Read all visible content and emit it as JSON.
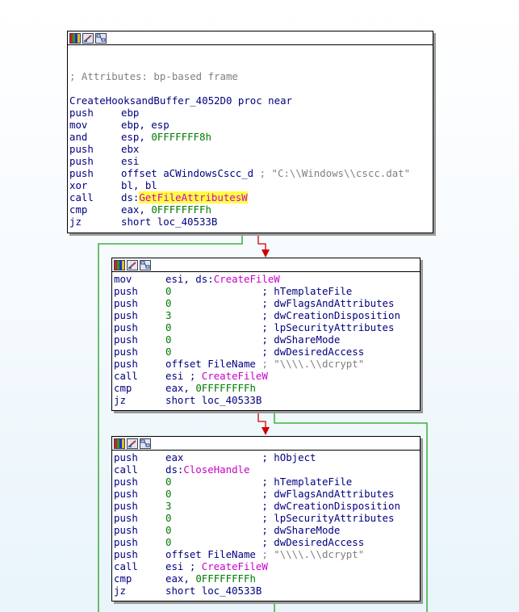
{
  "blocks": [
    {
      "id": "block-1",
      "lines": [
        {
          "kind": "blank"
        },
        {
          "kind": "blank"
        },
        {
          "kind": "comment",
          "text": "; Attributes: bp-based frame"
        },
        {
          "kind": "blank"
        },
        {
          "kind": "proc",
          "text": "CreateHooksandBuffer_4052D0 proc near"
        },
        {
          "kind": "instr",
          "mnem": "push",
          "parts": [
            {
              "t": "op",
              "v": "ebp"
            }
          ]
        },
        {
          "kind": "instr",
          "mnem": "mov",
          "parts": [
            {
              "t": "op",
              "v": "ebp, esp"
            }
          ]
        },
        {
          "kind": "instr",
          "mnem": "and",
          "parts": [
            {
              "t": "op",
              "v": "esp, "
            },
            {
              "t": "num",
              "v": "0FFFFFFF8h"
            }
          ]
        },
        {
          "kind": "instr",
          "mnem": "push",
          "parts": [
            {
              "t": "op",
              "v": "ebx"
            }
          ]
        },
        {
          "kind": "instr",
          "mnem": "push",
          "parts": [
            {
              "t": "op",
              "v": "esi"
            }
          ]
        },
        {
          "kind": "instr",
          "mnem": "push",
          "parts": [
            {
              "t": "op",
              "v": "offset aCWindowsCscc_d "
            },
            {
              "t": "cmt",
              "v": "; \"C:\\\\Windows\\\\cscc.dat\""
            }
          ]
        },
        {
          "kind": "instr",
          "mnem": "xor",
          "parts": [
            {
              "t": "op",
              "v": "bl, bl"
            }
          ]
        },
        {
          "kind": "instr",
          "mnem": "call",
          "parts": [
            {
              "t": "op",
              "v": "ds:"
            },
            {
              "t": "hl",
              "v": "GetFileAttributesW"
            }
          ]
        },
        {
          "kind": "instr",
          "mnem": "cmp",
          "parts": [
            {
              "t": "op",
              "v": "eax, "
            },
            {
              "t": "num",
              "v": "0FFFFFFFFh"
            }
          ]
        },
        {
          "kind": "instr",
          "mnem": "jz",
          "parts": [
            {
              "t": "op",
              "v": "short loc_40533B"
            }
          ]
        }
      ]
    },
    {
      "id": "block-2",
      "lines": [
        {
          "kind": "instr",
          "mnem": "mov",
          "parts": [
            {
              "t": "op",
              "v": "esi, ds:"
            },
            {
              "t": "imp",
              "v": "CreateFileW"
            }
          ]
        },
        {
          "kind": "instr",
          "mnem": "push",
          "parts": [
            {
              "t": "num",
              "v": "0               "
            },
            {
              "t": "op",
              "v": "; "
            },
            {
              "t": "cmtv",
              "v": "hTemplateFile"
            }
          ]
        },
        {
          "kind": "instr",
          "mnem": "push",
          "parts": [
            {
              "t": "num",
              "v": "0               "
            },
            {
              "t": "op",
              "v": "; "
            },
            {
              "t": "cmtv",
              "v": "dwFlagsAndAttributes"
            }
          ]
        },
        {
          "kind": "instr",
          "mnem": "push",
          "parts": [
            {
              "t": "num",
              "v": "3               "
            },
            {
              "t": "op",
              "v": "; "
            },
            {
              "t": "cmtv",
              "v": "dwCreationDisposition"
            }
          ]
        },
        {
          "kind": "instr",
          "mnem": "push",
          "parts": [
            {
              "t": "num",
              "v": "0               "
            },
            {
              "t": "op",
              "v": "; "
            },
            {
              "t": "cmtv",
              "v": "lpSecurityAttributes"
            }
          ]
        },
        {
          "kind": "instr",
          "mnem": "push",
          "parts": [
            {
              "t": "num",
              "v": "0               "
            },
            {
              "t": "op",
              "v": "; "
            },
            {
              "t": "cmtv",
              "v": "dwShareMode"
            }
          ]
        },
        {
          "kind": "instr",
          "mnem": "push",
          "parts": [
            {
              "t": "num",
              "v": "0               "
            },
            {
              "t": "op",
              "v": "; "
            },
            {
              "t": "cmtv",
              "v": "dwDesiredAccess"
            }
          ]
        },
        {
          "kind": "instr",
          "mnem": "push",
          "parts": [
            {
              "t": "op",
              "v": "offset FileName "
            },
            {
              "t": "cmt",
              "v": "; \"\\\\\\\\.\\\\dcrypt\""
            }
          ]
        },
        {
          "kind": "instr",
          "mnem": "call",
          "parts": [
            {
              "t": "op",
              "v": "esi ; "
            },
            {
              "t": "imp",
              "v": "CreateFileW"
            }
          ]
        },
        {
          "kind": "instr",
          "mnem": "cmp",
          "parts": [
            {
              "t": "op",
              "v": "eax, "
            },
            {
              "t": "num",
              "v": "0FFFFFFFFh"
            }
          ]
        },
        {
          "kind": "instr",
          "mnem": "jz",
          "parts": [
            {
              "t": "op",
              "v": "short loc_40533B"
            }
          ]
        }
      ]
    },
    {
      "id": "block-3",
      "lines": [
        {
          "kind": "instr",
          "mnem": "push",
          "parts": [
            {
              "t": "op",
              "v": "eax             ; "
            },
            {
              "t": "cmtv",
              "v": "hObject"
            }
          ]
        },
        {
          "kind": "instr",
          "mnem": "call",
          "parts": [
            {
              "t": "op",
              "v": "ds:"
            },
            {
              "t": "imp",
              "v": "CloseHandle"
            }
          ]
        },
        {
          "kind": "instr",
          "mnem": "push",
          "parts": [
            {
              "t": "num",
              "v": "0               "
            },
            {
              "t": "op",
              "v": "; "
            },
            {
              "t": "cmtv",
              "v": "hTemplateFile"
            }
          ]
        },
        {
          "kind": "instr",
          "mnem": "push",
          "parts": [
            {
              "t": "num",
              "v": "0               "
            },
            {
              "t": "op",
              "v": "; "
            },
            {
              "t": "cmtv",
              "v": "dwFlagsAndAttributes"
            }
          ]
        },
        {
          "kind": "instr",
          "mnem": "push",
          "parts": [
            {
              "t": "num",
              "v": "3               "
            },
            {
              "t": "op",
              "v": "; "
            },
            {
              "t": "cmtv",
              "v": "dwCreationDisposition"
            }
          ]
        },
        {
          "kind": "instr",
          "mnem": "push",
          "parts": [
            {
              "t": "num",
              "v": "0               "
            },
            {
              "t": "op",
              "v": "; "
            },
            {
              "t": "cmtv",
              "v": "lpSecurityAttributes"
            }
          ]
        },
        {
          "kind": "instr",
          "mnem": "push",
          "parts": [
            {
              "t": "num",
              "v": "0               "
            },
            {
              "t": "op",
              "v": "; "
            },
            {
              "t": "cmtv",
              "v": "dwShareMode"
            }
          ]
        },
        {
          "kind": "instr",
          "mnem": "push",
          "parts": [
            {
              "t": "num",
              "v": "0               "
            },
            {
              "t": "op",
              "v": "; "
            },
            {
              "t": "cmtv",
              "v": "dwDesiredAccess"
            }
          ]
        },
        {
          "kind": "instr",
          "mnem": "push",
          "parts": [
            {
              "t": "op",
              "v": "offset FileName "
            },
            {
              "t": "cmt",
              "v": "; \"\\\\\\\\.\\\\dcrypt\""
            }
          ]
        },
        {
          "kind": "instr",
          "mnem": "call",
          "parts": [
            {
              "t": "op",
              "v": "esi ; "
            },
            {
              "t": "imp",
              "v": "CreateFileW"
            }
          ]
        },
        {
          "kind": "instr",
          "mnem": "cmp",
          "parts": [
            {
              "t": "op",
              "v": "eax, "
            },
            {
              "t": "num",
              "v": "0FFFFFFFFh"
            }
          ]
        },
        {
          "kind": "instr",
          "mnem": "jz",
          "parts": [
            {
              "t": "op",
              "v": "short loc_40533B"
            }
          ]
        }
      ]
    }
  ],
  "header_icons": [
    "palette-icon",
    "pencil-icon",
    "graph-overview-icon"
  ],
  "colors": {
    "edge_true": "#20a020",
    "edge_false": "#d00000",
    "mnemonic": "#000080",
    "number": "#007a00",
    "import": "#c800c8",
    "comment": "#808080",
    "highlight": "#ffff40"
  }
}
